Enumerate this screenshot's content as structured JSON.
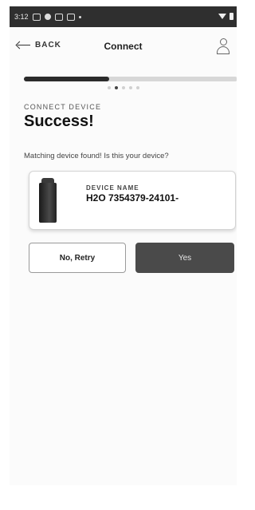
{
  "status_bar": {
    "time": "3:12"
  },
  "header": {
    "back_label": "BACK",
    "title": "Connect"
  },
  "progress": {
    "fraction": 0.4,
    "steps": 5,
    "active_step": 2
  },
  "section": {
    "label": "CONNECT DEVICE",
    "title": "Success!"
  },
  "question": "Matching device found! Is this your device?",
  "device": {
    "name_label": "DEVICE NAME",
    "name_value": "H2O 7354379-24101-"
  },
  "buttons": {
    "retry": "No, Retry",
    "yes": "Yes"
  }
}
